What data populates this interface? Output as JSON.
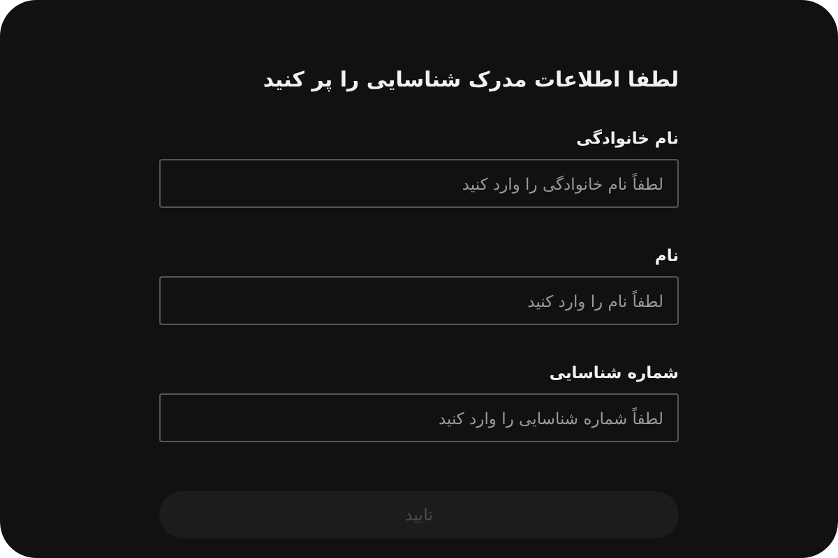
{
  "title": "لطفا اطلاعات مدرک شناسایی را پر کنید",
  "fields": [
    {
      "label": "نام خانوادگی",
      "placeholder": "لطفاً نام خانوادگی را وارد کنید"
    },
    {
      "label": "نام",
      "placeholder": "لطفاً نام را وارد کنید"
    },
    {
      "label": "شماره شناسایی",
      "placeholder": "لطفاً شماره شناسایی را وارد کنید"
    }
  ],
  "submit": {
    "label": "تایید",
    "disabled": true
  }
}
